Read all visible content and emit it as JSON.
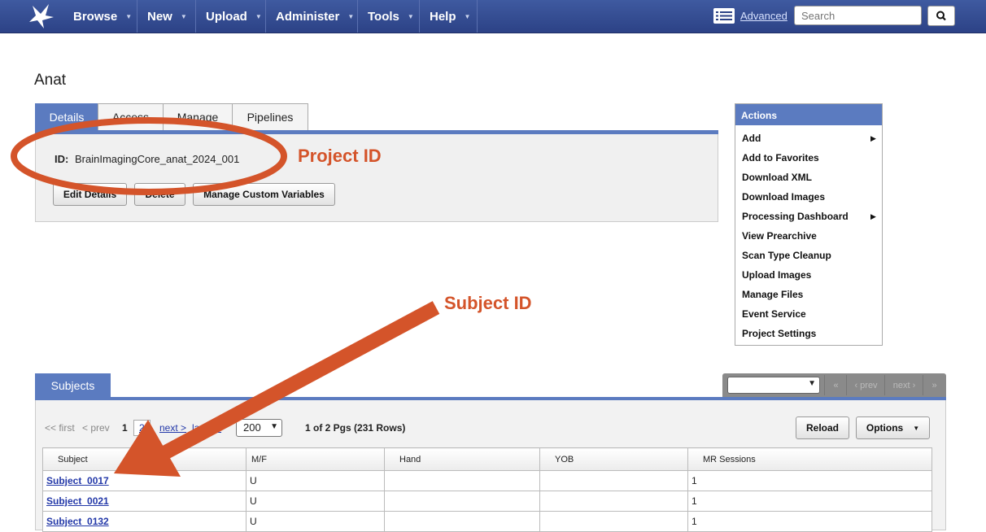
{
  "nav": {
    "menus": [
      "Browse",
      "New",
      "Upload",
      "Administer",
      "Tools",
      "Help"
    ],
    "advanced_label": "Advanced",
    "search_placeholder": "Search",
    "brand_color": "#3f5aa0"
  },
  "page": {
    "title": "Anat",
    "tabs": [
      "Details",
      "Access",
      "Manage",
      "Pipelines"
    ],
    "active_tab": "Details"
  },
  "details": {
    "id_label": "ID:",
    "id_value": "BrainImagingCore_anat_2024_001",
    "buttons": [
      "Edit Details",
      "Delete",
      "Manage Custom Variables"
    ]
  },
  "actions": {
    "header": "Actions",
    "items": [
      {
        "label": "Add",
        "submenu": true
      },
      {
        "label": "Add to Favorites",
        "submenu": false
      },
      {
        "label": "Download XML",
        "submenu": false
      },
      {
        "label": "Download Images",
        "submenu": false
      },
      {
        "label": "Processing Dashboard",
        "submenu": true
      },
      {
        "label": "View Prearchive",
        "submenu": false
      },
      {
        "label": "Scan Type Cleanup",
        "submenu": false
      },
      {
        "label": "Upload Images",
        "submenu": false
      },
      {
        "label": "Manage Files",
        "submenu": false
      },
      {
        "label": "Event Service",
        "submenu": false
      },
      {
        "label": "Project Settings",
        "submenu": false
      }
    ]
  },
  "subjects": {
    "tab_label": "Subjects",
    "pager": {
      "first": "<< first",
      "prev": "< prev",
      "current": "1",
      "page2": "2",
      "next": "next >",
      "last": "last >>",
      "per_page": "200",
      "summary": "1 of 2 Pgs (231 Rows)"
    },
    "nav_buttons": {
      "first": "«",
      "prev": "‹ prev",
      "next": "next ›",
      "last": "»"
    },
    "reload_label": "Reload",
    "options_label": "Options",
    "columns": [
      "Subject",
      "M/F",
      "Hand",
      "YOB",
      "MR Sessions"
    ],
    "rows": [
      [
        "Subject_0017",
        "U",
        "",
        "",
        "1"
      ],
      [
        "Subject_0021",
        "U",
        "",
        "",
        "1"
      ],
      [
        "Subject_0132",
        "U",
        "",
        "",
        "1"
      ]
    ]
  },
  "annotations": {
    "project_id": "Project ID",
    "subject_id": "Subject ID",
    "color": "#d4542a"
  }
}
